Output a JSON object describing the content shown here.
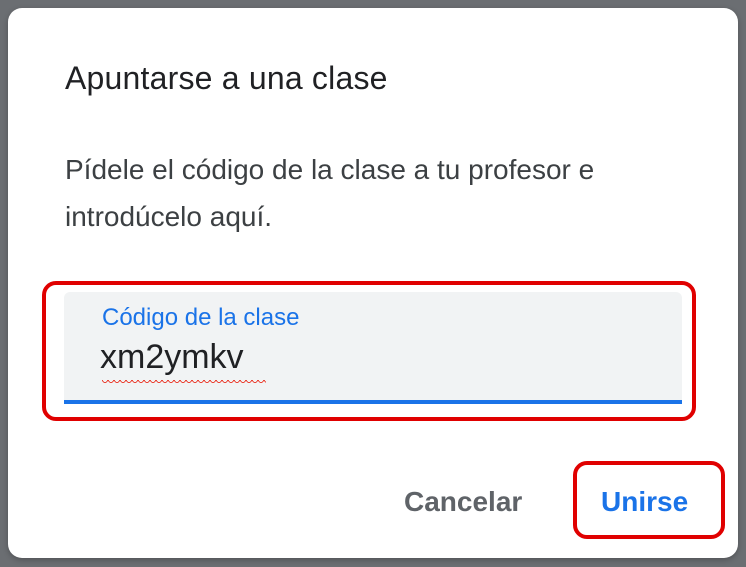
{
  "dialog": {
    "title": "Apuntarse a una clase",
    "description": "Pídele el código de la clase a tu profesor e introdúcelo aquí.",
    "field": {
      "label": "Código de la clase",
      "value": "xm2ymkv"
    },
    "buttons": {
      "cancel": "Cancelar",
      "join": "Unirse"
    }
  },
  "colors": {
    "accent": "#1a73e8",
    "highlight": "#e00000",
    "field_background": "#f1f3f4"
  }
}
